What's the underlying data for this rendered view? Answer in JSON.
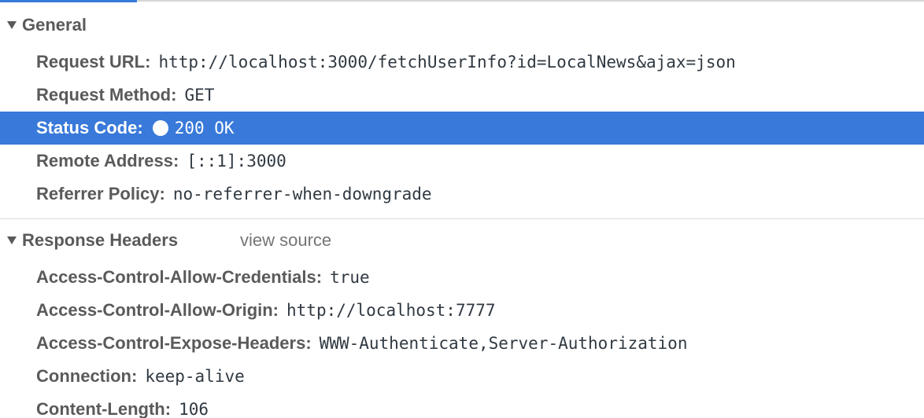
{
  "sections": {
    "general": {
      "title": "General",
      "rows": [
        {
          "key": "Request URL:",
          "value": "http://localhost:3000/fetchUserInfo?id=LocalNews&ajax=json"
        },
        {
          "key": "Request Method:",
          "value": "GET"
        },
        {
          "key": "Status Code:",
          "value": "200 OK",
          "status_color": "#ffffff"
        },
        {
          "key": "Remote Address:",
          "value": "[::1]:3000"
        },
        {
          "key": "Referrer Policy:",
          "value": "no-referrer-when-downgrade"
        }
      ]
    },
    "response_headers": {
      "title": "Response Headers",
      "view_source_label": "view source",
      "rows": [
        {
          "key": "Access-Control-Allow-Credentials:",
          "value": "true"
        },
        {
          "key": "Access-Control-Allow-Origin:",
          "value": "http://localhost:7777"
        },
        {
          "key": "Access-Control-Expose-Headers:",
          "value": "WWW-Authenticate,Server-Authorization"
        },
        {
          "key": "Connection:",
          "value": "keep-alive"
        },
        {
          "key": "Content-Length:",
          "value": "106"
        }
      ]
    }
  },
  "colors": {
    "selection": "#3879d9",
    "key_text": "#5a5a5a",
    "value_text": "#303942",
    "view_source": "#757575"
  },
  "icons": {
    "collapse_triangle": "triangle-down-icon",
    "status": "status-dot-icon"
  }
}
